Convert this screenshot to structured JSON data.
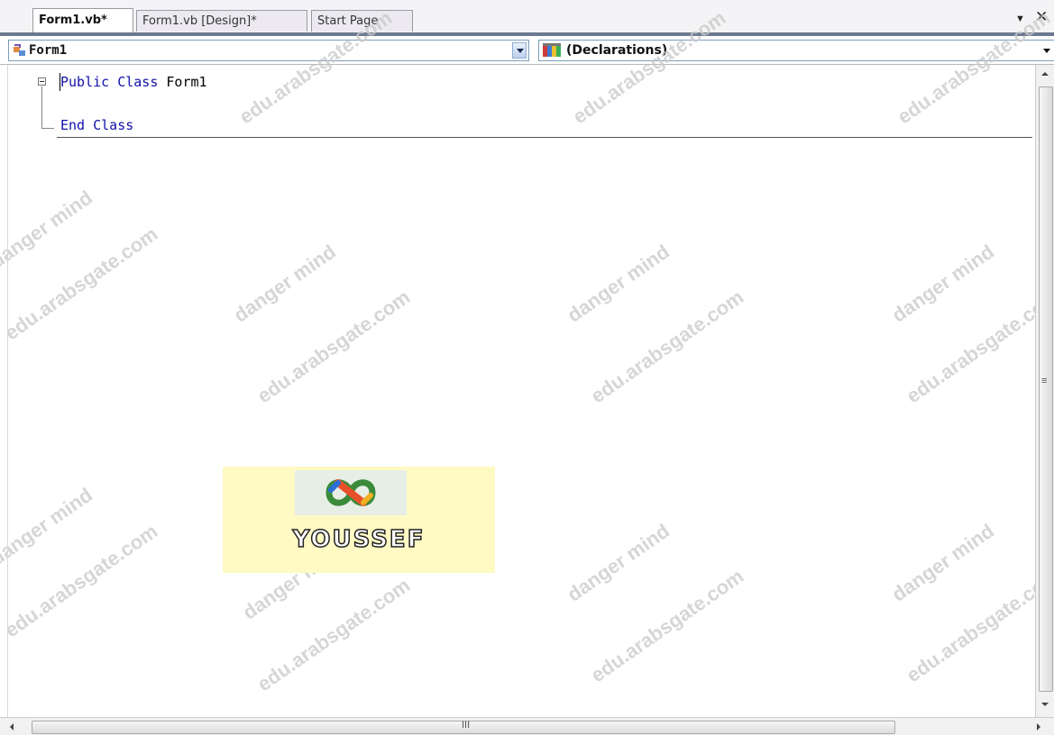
{
  "tabs": [
    {
      "label": "Form1.vb*",
      "active": true
    },
    {
      "label": "Form1.vb [Design]*",
      "active": false
    },
    {
      "label": "Start Page",
      "active": false
    }
  ],
  "tab_controls": {
    "dropdown_icon": "chevron-down-icon",
    "close_icon": "close-icon"
  },
  "nav": {
    "class_combo": {
      "value": "Form1",
      "icon": "class-icon"
    },
    "member_combo": {
      "value": "(Declarations)",
      "icon": "declarations-icon"
    }
  },
  "code": {
    "line1": {
      "kw": "Public Class ",
      "name": "Form1"
    },
    "line3": {
      "kw": "End Class"
    }
  },
  "logo": {
    "text": "YOUSSEF"
  },
  "watermarks": [
    "danger mind",
    "edu.arabsgate.com"
  ],
  "scrollbar": {
    "h_grip": "III"
  },
  "colors": {
    "keyword": "#1111aa",
    "tab_line": "#6b7a8f",
    "logo_bg": "#fff9c4"
  }
}
